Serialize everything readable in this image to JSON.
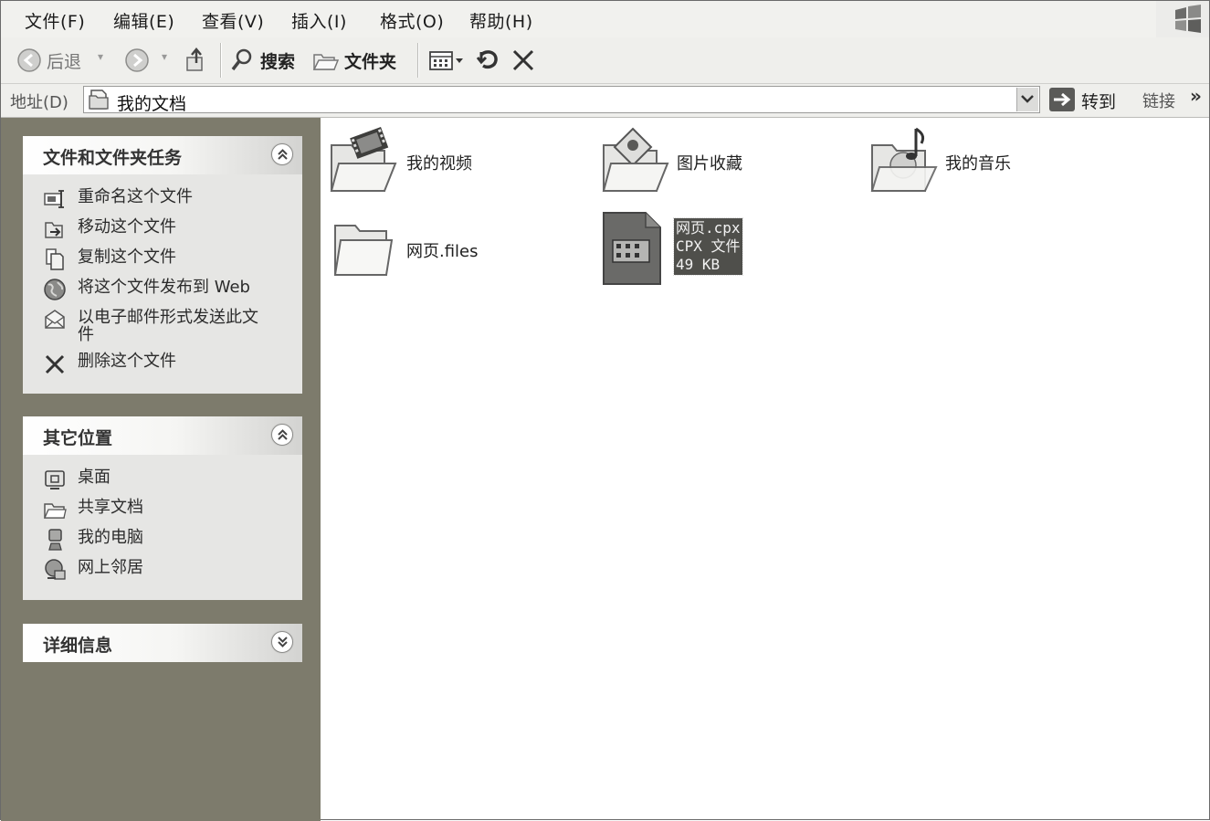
{
  "menu": [
    "文件(F)",
    "编辑(E)",
    "查看(V)",
    "插入(I)",
    "格式(O)",
    "帮助(H)"
  ],
  "toolbar": {
    "back_label": "后退",
    "search_label": "搜索",
    "folders_label": "文件夹"
  },
  "address": {
    "label": "地址(D)",
    "value": "我的文档",
    "go_label": "转到",
    "links_label": "链接",
    "more_chevron": "»"
  },
  "tasks_panel": {
    "title": "文件和文件夹任务",
    "items": [
      {
        "label": "重命名这个文件",
        "icon": "rename-icon"
      },
      {
        "label": "移动这个文件",
        "icon": "move-icon"
      },
      {
        "label": "复制这个文件",
        "icon": "copy-icon"
      },
      {
        "label": "将这个文件发布到 Web",
        "icon": "globe-icon"
      },
      {
        "label": "以电子邮件形式发送此文件",
        "icon": "email-icon"
      },
      {
        "label": "删除这个文件",
        "icon": "delete-icon"
      }
    ]
  },
  "places_panel": {
    "title": "其它位置",
    "items": [
      {
        "label": "桌面",
        "icon": "desktop-icon"
      },
      {
        "label": "共享文档",
        "icon": "shared-folder-icon"
      },
      {
        "label": "我的电脑",
        "icon": "computer-icon"
      },
      {
        "label": "网上邻居",
        "icon": "network-icon"
      }
    ]
  },
  "details_panel": {
    "title": "详细信息"
  },
  "files": [
    {
      "name": "我的视频",
      "icon": "video-folder-icon"
    },
    {
      "name": "图片收藏",
      "icon": "pictures-folder-icon"
    },
    {
      "name": "我的音乐",
      "icon": "music-folder-icon"
    },
    {
      "name": "网页.files",
      "icon": "folder-icon"
    },
    {
      "name": "网页.cpx",
      "type": "CPX 文件",
      "size": "49 KB",
      "icon": "cpx-file-icon",
      "selected": true
    }
  ],
  "colors": {
    "task_pane_bg": "#7d7b6c",
    "panel_bg": "#e6e6e4",
    "selection_bg": "#4f4f4b"
  }
}
